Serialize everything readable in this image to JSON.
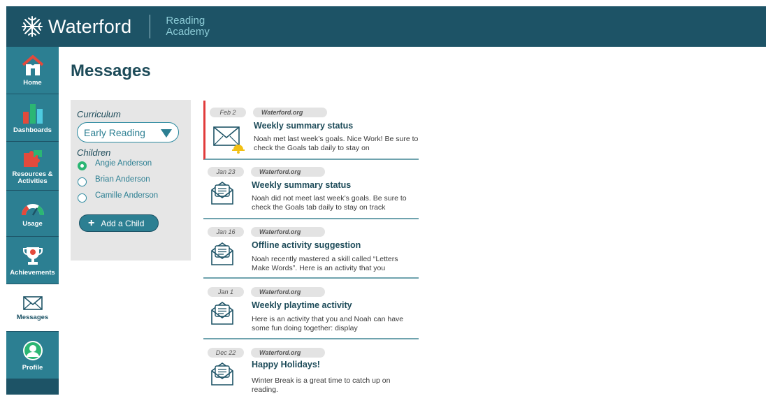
{
  "header": {
    "brand": "Waterford",
    "product_line1": "Reading",
    "product_line2": "Academy",
    "logo_icon": "waterford-star-logo"
  },
  "sidebar": {
    "items": [
      {
        "label": "Home",
        "icon": "house-icon"
      },
      {
        "label": "Dashboards",
        "icon": "bar-chart-icon"
      },
      {
        "label": "Resources & Activities",
        "icon": "puzzle-icon"
      },
      {
        "label": "Usage",
        "icon": "gauge-icon"
      },
      {
        "label": "Achievements",
        "icon": "trophy-icon"
      },
      {
        "label": "Messages",
        "icon": "envelope-icon",
        "active": true
      },
      {
        "label": "Profile",
        "icon": "person-icon"
      }
    ]
  },
  "page": {
    "title": "Messages"
  },
  "filters": {
    "curriculum_label": "Curriculum",
    "curriculum_value": "Early Reading",
    "children_label": "Children",
    "children": [
      {
        "name": "Angie Anderson",
        "selected": true
      },
      {
        "name": "Brian Anderson",
        "selected": false
      },
      {
        "name": "Camille Anderson",
        "selected": false
      }
    ],
    "add_child_label": "Add a Child"
  },
  "messages": [
    {
      "date": "Feb 2",
      "sender": "Waterford.org",
      "title": "Weekly summary status",
      "preview": "Noah met last week’s goals. Nice Work! Be sure to check the Goals tab daily to stay on",
      "unread": true,
      "icon": "envelope-bell-icon"
    },
    {
      "date": "Jan 23",
      "sender": "Waterford.org",
      "title": "Weekly summary status",
      "preview": "Noah did not meet last week’s goals. Be sure to check the Goals tab daily to stay on track",
      "unread": false,
      "icon": "open-envelope-icon"
    },
    {
      "date": "Jan 16",
      "sender": "Waterford.org",
      "title": "Offline activity suggestion",
      "preview": "Noah recently mastered a skill called “Letters Make Words”.  Here is an activity that you",
      "unread": false,
      "icon": "open-envelope-icon"
    },
    {
      "date": "Jan 1",
      "sender": "Waterford.org",
      "title": "Weekly playtime activity",
      "preview": "Here is an activity that you and Noah can have some fun doing together: display",
      "unread": false,
      "icon": "open-envelope-icon"
    },
    {
      "date": "Dec 22",
      "sender": "Waterford.org",
      "title": "Happy Holidays!",
      "preview": "Winter Break is a great time to catch up on reading.",
      "unread": false,
      "icon": "open-envelope-icon"
    }
  ],
  "colors": {
    "header_bg": "#1d5366",
    "nav_bg": "#2c7f92",
    "accent_teal": "#2c7f92",
    "title_text": "#1d4b59",
    "unread_marker": "#e13b3b",
    "radio_selected": "#2bb673"
  }
}
